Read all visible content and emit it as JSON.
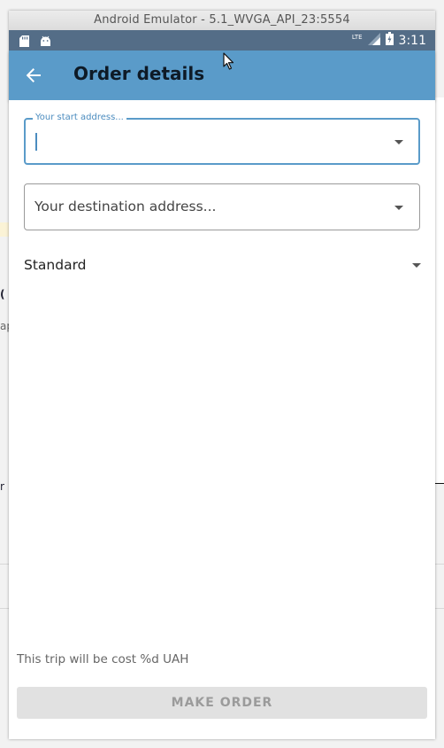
{
  "window": {
    "title": "Android Emulator - 5.1_WVGA_API_23:5554"
  },
  "status_bar": {
    "time": "3:11",
    "network": "LTE",
    "left_icons": [
      "sd-card-icon",
      "android-icon"
    ],
    "right_icons": [
      "signal-icon",
      "battery-icon"
    ]
  },
  "app_bar": {
    "title": "Order details",
    "back_icon": "arrow-left-icon"
  },
  "form": {
    "start_address": {
      "label": "Your start address...",
      "value": ""
    },
    "destination_address": {
      "placeholder": "Your destination address...",
      "value": ""
    },
    "tariff": {
      "selected": "Standard"
    },
    "cost_text": "This trip will be cost %d UAH",
    "order_button": "MAKE ORDER"
  },
  "colors": {
    "status_bar": "#546d87",
    "app_bar": "#5a9bc9",
    "accent": "#4b8cbf",
    "button_disabled_bg": "#e1e1e1",
    "button_disabled_text": "#9b9b9b"
  }
}
